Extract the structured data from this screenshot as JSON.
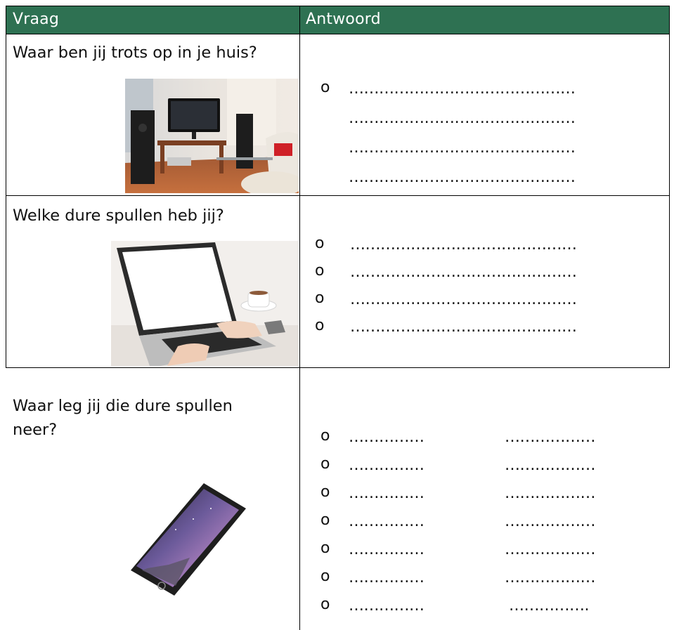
{
  "table": {
    "header": {
      "question": "Vraag",
      "answer": "Antwoord"
    },
    "colors": {
      "header_bg": "#2e7152",
      "header_text": "#ffffff"
    },
    "rows": [
      {
        "question": "Waar ben jij trots op in je huis?",
        "image": "living-room-tv-photo",
        "bullet": "o",
        "answer_lines": [
          "………………………………………",
          "………………………………………",
          "………………………………………",
          "………………………………………"
        ]
      },
      {
        "question": "Welke dure spullen heb jij?",
        "image": "laptop-photo",
        "bullets": [
          "o",
          "o",
          "o",
          "o"
        ],
        "answer_lines": [
          "………………………………………",
          "………………………………………",
          "………………………………………",
          "………………………………………"
        ]
      },
      {
        "question_line1": "Waar leg jij die dure spullen",
        "question_line2": "neer?",
        "image": "smartphone-photo",
        "bullets": [
          "o",
          "o",
          "o",
          "o",
          "o",
          "o",
          "o"
        ],
        "left_lines": [
          "……………",
          "……………",
          "……………",
          "……………",
          "……………",
          "……………",
          "……………"
        ],
        "right_lines": [
          "………………",
          "………………",
          "………………",
          "………………",
          "………………",
          "………………",
          "……………."
        ]
      }
    ]
  }
}
